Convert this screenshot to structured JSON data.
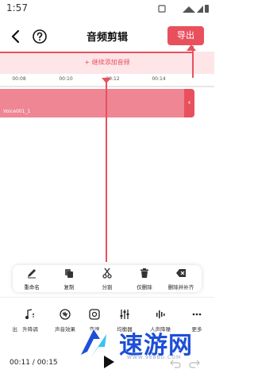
{
  "status_bar": {
    "time": "1:57"
  },
  "header": {
    "title": "音频剪辑",
    "export_label": "导出"
  },
  "add_audio": {
    "label": "+ 继续添加音频"
  },
  "ruler": {
    "ticks": [
      "00:08",
      "00:10",
      "00:12",
      "00:14"
    ]
  },
  "track": {
    "label": "Voice001_1",
    "handle_glyph": "‹"
  },
  "edit_toolbar": {
    "items": [
      {
        "label": "重命名",
        "icon": "pencil-icon"
      },
      {
        "label": "复制",
        "icon": "copy-icon"
      },
      {
        "label": "分割",
        "icon": "scissors-icon"
      },
      {
        "label": "仅删除",
        "icon": "trash-icon"
      },
      {
        "label": "删除并补齐",
        "icon": "backspace-icon"
      }
    ]
  },
  "bottom_tools": {
    "items": [
      {
        "label": "出",
        "icon": "partial-icon"
      },
      {
        "label": "升降调",
        "icon": "pitch-icon"
      },
      {
        "label": "声音效果",
        "icon": "sound-effect-icon"
      },
      {
        "label": "变速",
        "icon": "speed-icon"
      },
      {
        "label": "均衡器",
        "icon": "equalizer-icon"
      },
      {
        "label": "人声降噪",
        "icon": "denoise-icon"
      },
      {
        "label": "更多",
        "icon": "more-icon"
      }
    ]
  },
  "playback": {
    "current": "00:11",
    "separator": " / ",
    "total": "00:15"
  },
  "watermark": {
    "text": "速游网",
    "url": "WWW.968BG.COM"
  },
  "colors": {
    "accent": "#e9505d",
    "track": "#ee8694",
    "add_bar": "#fde5e8"
  }
}
